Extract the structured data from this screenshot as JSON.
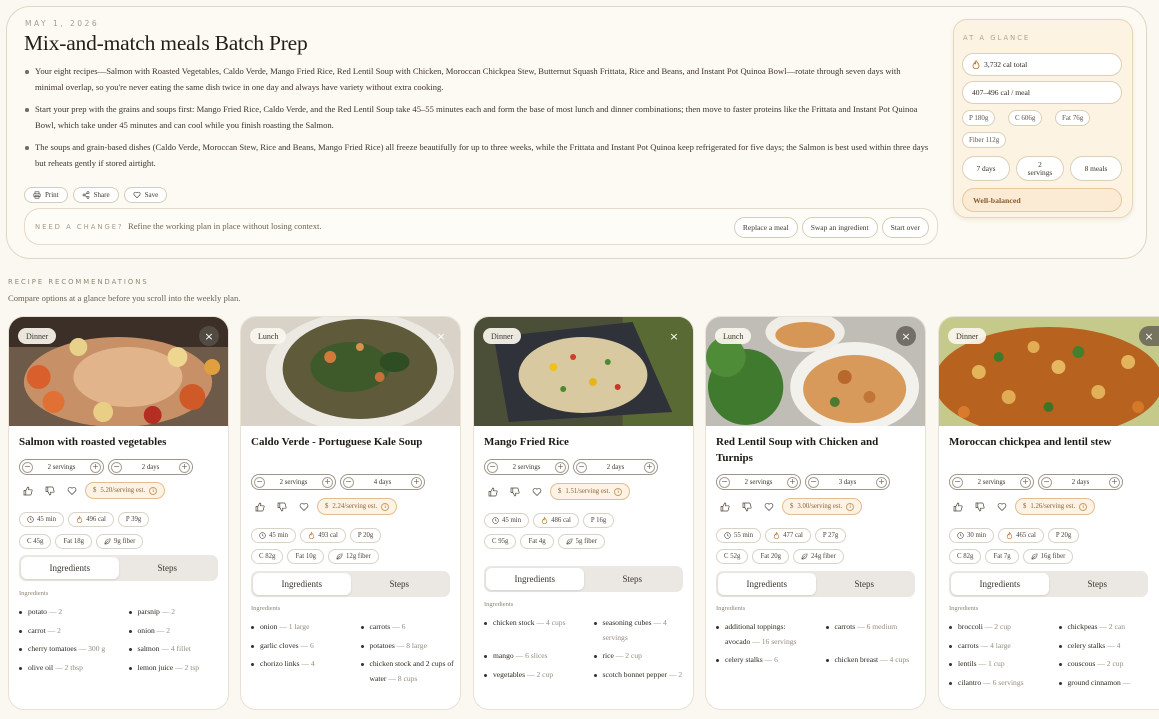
{
  "header": {
    "date": "MAY 1, 2026",
    "title": "Mix-and-match meals Batch Prep",
    "bullets": [
      "Your eight recipes—Salmon with Roasted Vegetables, Caldo Verde, Mango Fried Rice, Red Lentil Soup with Chicken, Moroccan Chickpea Stew, Butternut Squash Frittata, Rice and Beans, and Instant Pot Quinoa Bowl—rotate through seven days with minimal overlap, so you're never eating the same dish twice in one day and always have variety without extra cooking.",
      "Start your prep with the grains and soups first: Mango Fried Rice, Caldo Verde, and the Red Lentil Soup take 45–55 minutes each and form the base of most lunch and dinner combinations; then move to faster proteins like the Frittata and Instant Pot Quinoa Bowl, which take under 45 minutes and can cool while you finish roasting the Salmon.",
      "The soups and grain-based dishes (Caldo Verde, Moroccan Stew, Rice and Beans, Mango Fried Rice) all freeze beautifully for up to three weeks, while the Frittata and Instant Pot Quinoa keep refrigerated for five days; the Salmon is best used within three days but reheats gently if stored airtight."
    ],
    "actions": {
      "print": "Print",
      "share": "Share",
      "save": "Save"
    },
    "change": {
      "label": "NEED A CHANGE?",
      "text": "Refine the working plan in place without losing context.",
      "replace": "Replace a meal",
      "swap": "Swap an ingredient",
      "start_over": "Start over"
    }
  },
  "glance": {
    "label": "AT A GLANCE",
    "cal_total": "3,732 cal total",
    "cal_meal": "407–496 cal / meal",
    "protein": "P 180g",
    "carbs": "C 606g",
    "fat": "Fat 76g",
    "fiber": "Fiber 112g",
    "days": "7 days",
    "servings_num": "2",
    "servings_word": "servings",
    "meals": "8 meals",
    "balance": "Well-balanced"
  },
  "recommendations": {
    "label": "RECIPE RECOMMENDATIONS",
    "subtitle": "Compare options at a glance before you scroll into the weekly plan."
  },
  "cards": [
    {
      "tag": "Dinner",
      "title": "Salmon with roasted vegetables",
      "servings": "2 servings",
      "days": "2 days",
      "price": "5.20/serving est.",
      "time": "45 min",
      "cal": "496 cal",
      "protein": "P 39g",
      "carbs": "C 45g",
      "fat": "Fat 18g",
      "fiber": "9g fiber",
      "tab_ingredients": "Ingredients",
      "tab_steps": "Steps",
      "ing_label": "Ingredients",
      "ingredients": [
        {
          "name": "potato",
          "amount": "— 2"
        },
        {
          "name": "parsnip",
          "amount": "— 2"
        },
        {
          "name": "carrot",
          "amount": "— 2"
        },
        {
          "name": "onion",
          "amount": "— 2"
        },
        {
          "name": "cherry tomatoes",
          "amount": "— 300 g"
        },
        {
          "name": "salmon",
          "amount": "— 4 fillet"
        },
        {
          "name": "olive oil",
          "amount": "— 2 tbsp"
        },
        {
          "name": "lemon juice",
          "amount": "— 2 tsp"
        }
      ]
    },
    {
      "tag": "Lunch",
      "title": "Caldo Verde - Portuguese Kale Soup",
      "servings": "2 servings",
      "days": "4 days",
      "price": "2.24/serving est.",
      "time": "45 min",
      "cal": "493 cal",
      "protein": "P 20g",
      "carbs": "C 82g",
      "fat": "Fat 10g",
      "fiber": "12g fiber",
      "tab_ingredients": "Ingredients",
      "tab_steps": "Steps",
      "ing_label": "Ingredients",
      "ingredients": [
        {
          "name": "onion",
          "amount": "— 1 large"
        },
        {
          "name": "carrots",
          "amount": "— 6"
        },
        {
          "name": "garlic cloves",
          "amount": "— 6"
        },
        {
          "name": "potatoes",
          "amount": "— 8 large"
        },
        {
          "name": "chorizo links",
          "amount": "— 4"
        },
        {
          "name": "chicken stock and 2 cups of water",
          "amount": "— 8 cups"
        }
      ]
    },
    {
      "tag": "Dinner",
      "title": "Mango Fried Rice",
      "servings": "2 servings",
      "days": "2 days",
      "price": "1.51/serving est.",
      "time": "45 min",
      "cal": "486 cal",
      "protein": "P 16g",
      "carbs": "C 95g",
      "fat": "Fat 4g",
      "fiber": "5g fiber",
      "tab_ingredients": "Ingredients",
      "tab_steps": "Steps",
      "ing_label": "Ingredients",
      "ingredients": [
        {
          "name": "chicken stock",
          "amount": "— 4 cups"
        },
        {
          "name": "seasoning cubes",
          "amount": "— 4 servings"
        },
        {
          "name": "mango",
          "amount": "— 6 slices"
        },
        {
          "name": "rice",
          "amount": "— 2 cup"
        },
        {
          "name": "vegetables",
          "amount": "— 2 cup"
        },
        {
          "name": "scotch bonnet pepper",
          "amount": "— 2"
        }
      ]
    },
    {
      "tag": "Lunch",
      "title": "Red Lentil Soup with Chicken and Turnips",
      "servings": "2 servings",
      "days": "3 days",
      "price": "3.00/serving est.",
      "time": "55 min",
      "cal": "477 cal",
      "protein": "P 27g",
      "carbs": "C 52g",
      "fat": "Fat 20g",
      "fiber": "24g fiber",
      "tab_ingredients": "Ingredients",
      "tab_steps": "Steps",
      "ing_label": "Ingredients",
      "ingredients": [
        {
          "name": "additional toppings: avocado",
          "amount": "— 16 servings"
        },
        {
          "name": "carrots",
          "amount": "— 6 medium"
        },
        {
          "name": "celery stalks",
          "amount": "— 6"
        },
        {
          "name": "chicken breast",
          "amount": "— 4 cups"
        }
      ]
    },
    {
      "tag": "Dinner",
      "title": "Moroccan chickpea and lentil stew",
      "servings": "2 servings",
      "days": "2 days",
      "price": "1.26/serving est.",
      "time": "30 min",
      "cal": "465 cal",
      "protein": "P 20g",
      "carbs": "C 82g",
      "fat": "Fat 7g",
      "fiber": "16g fiber",
      "tab_ingredients": "Ingredients",
      "tab_steps": "Steps",
      "ing_label": "Ingredients",
      "ingredients": [
        {
          "name": "broccoli",
          "amount": "— 2 cup"
        },
        {
          "name": "chickpeas",
          "amount": "— 2 can"
        },
        {
          "name": "carrots",
          "amount": "— 4 large"
        },
        {
          "name": "celery stalks",
          "amount": "— 4"
        },
        {
          "name": "lentils",
          "amount": "— 1 cup"
        },
        {
          "name": "couscous",
          "amount": "— 2 cup"
        },
        {
          "name": "cilantro",
          "amount": "— 6 servings"
        },
        {
          "name": "ground cinnamon",
          "amount": "—"
        }
      ]
    }
  ]
}
